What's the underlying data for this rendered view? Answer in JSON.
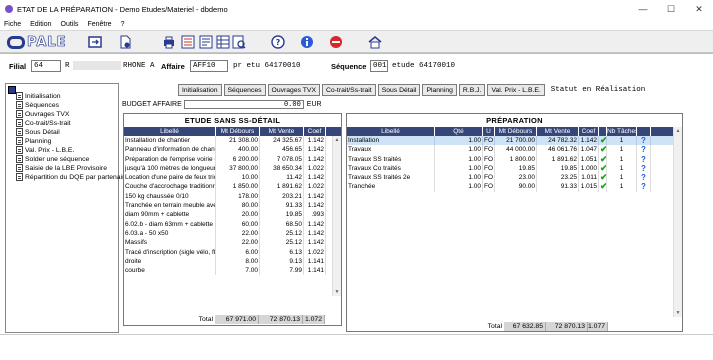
{
  "window": {
    "title": "ETAT DE LA PRÉPARATION - Demo Etudes/Materiel - dbdemo",
    "minimize": "—",
    "maximize": "☐",
    "close": "✕"
  },
  "menu": [
    "Fiche",
    "Edition",
    "Outils",
    "Fenêtre",
    "?"
  ],
  "logo": "PALE",
  "filiale": {
    "label": "Filial",
    "code": "64",
    "code2": "R",
    "name": "RHONE A",
    "affaire_label": "Affaire",
    "affaire_code": "AFF10",
    "affaire_text": "pr etu 64170010",
    "sequence_label": "Séquence",
    "sequence_code": "001",
    "sequence_text": "etude 64170010"
  },
  "tree": {
    "items": [
      "Initialisation",
      "Séquences",
      "Ouvrages TVX",
      "Co-trait/Ss-trait",
      "Sous Détail",
      "Planning",
      "Val. Prix - L.B.E.",
      "Solder une séquence",
      "Saisie de la LBE Provisoire",
      "Répartition du DQE par partenaire"
    ]
  },
  "buttons": [
    "Initialisation",
    "Séquences",
    "Ouvrages TVX",
    "Co-trait/Ss-trait",
    "Sous Détail",
    "Planning",
    "R.B.J.",
    "Val. Prix - L.B.E."
  ],
  "statut": "Statut en Réalisation",
  "budget": {
    "label": "BUDGET AFFAIRE",
    "value": "0.00",
    "currency": "EUR"
  },
  "grid1": {
    "title": "ETUDE SANS SS-DÉTAIL",
    "headers": [
      "Libellé",
      "Mt Débours",
      "Mt Vente",
      "Coef"
    ],
    "rows": [
      [
        "Installation de chantier",
        "21 308.00",
        "24 325.67",
        "1.142"
      ],
      [
        "Panneau d'information de chant",
        "400.00",
        "456.65",
        "1.142"
      ],
      [
        "Préparation de l'emprise voirie -",
        "6 200.00",
        "7 078.05",
        "1.142"
      ],
      [
        "jusqu'à 100 mètres de longueur",
        "37 800.00",
        "38 650.34",
        "1.022"
      ],
      [
        "Location d'une paire de feux tric",
        "10.00",
        "11.42",
        "1.142"
      ],
      [
        "Couche d'accrochage traditionr",
        "1 850.00",
        "1 891.62",
        "1.022"
      ],
      [
        "150 kg chaussée 0/10",
        "178.00",
        "203.21",
        "1.142"
      ],
      [
        "Tranchée en terrain meuble ave",
        "80.00",
        "91.33",
        "1.142"
      ],
      [
        " diam 90mm + cablette",
        "20.00",
        "19.85",
        ".993"
      ],
      [
        "6.02.b - diam 63mm + cablette",
        "60.00",
        "68.50",
        "1.142"
      ],
      [
        "6.03.a - 50 x50",
        "22.00",
        "25.12",
        "1.142"
      ],
      [
        "Massifs",
        "22.00",
        "25.12",
        "1.142"
      ],
      [
        "Tracé d'inscription (sigle vélo, fl",
        "6.00",
        "6.13",
        "1.022"
      ],
      [
        " droite",
        "8.00",
        "9.13",
        "1.141"
      ],
      [
        " courbe",
        "7.00",
        "7.99",
        "1.141"
      ]
    ],
    "total_label": "Total",
    "total_debours": "67 971.00",
    "total_vente": "72 870.13",
    "total_coef": "1.072"
  },
  "grid2": {
    "title": "PRÉPARATION",
    "headers": [
      "Libellé",
      "Qté",
      "U",
      "Mt Débours",
      "Mt Vente",
      "Coef",
      "",
      "Nb Tâches",
      ""
    ],
    "rows": [
      [
        "Installation",
        "1.00",
        "FO",
        "21 700.00",
        "24 782.32",
        "1.142",
        "1"
      ],
      [
        "Travaux",
        "1.00",
        "FO",
        "44 000.00",
        "46 061.76",
        "1.047",
        "1"
      ],
      [
        "Travaux SS traités",
        "1.00",
        "FO",
        "1 800.00",
        "1 891.62",
        "1.051",
        "1"
      ],
      [
        "Travaux Co traités",
        "1.00",
        "FO",
        "19.85",
        "19.85",
        "1.000",
        "1"
      ],
      [
        "Travaux SS traités 2e",
        "1.00",
        "FO",
        "23.00",
        "23.25",
        "1.011",
        "1"
      ],
      [
        "Tranchée",
        "1.00",
        "FO",
        "90.00",
        "91.33",
        "1.015",
        "1"
      ]
    ],
    "total_label": "Total",
    "total_debours": "67 632.85",
    "total_vente": "72 870.13",
    "total_coef": "1.077"
  }
}
